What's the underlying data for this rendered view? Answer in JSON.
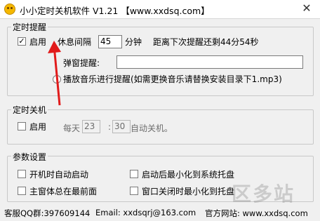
{
  "window": {
    "title": "小小定时关机软件 V1.21 【www.xxdsq.com】",
    "close_glyph": "✕"
  },
  "reminder": {
    "legend": "定时提醒",
    "enable_label": "启用",
    "enable_checked": true,
    "interval_label": "休息间隔",
    "interval_value": "45",
    "interval_unit": "分钟",
    "countdown_text": "距离下次提醒还剩44分54秒",
    "popup_label": "弹窗提醒:",
    "popup_value": "",
    "music_label": "播放音乐进行提醒(如需更换音乐请替换安装目录下1.mp3)"
  },
  "shutdown": {
    "legend": "定时关机",
    "enable_label": "启用",
    "enable_checked": false,
    "daily_label": "每天",
    "hour_value": "23",
    "separator": ":",
    "minute_value": "30",
    "suffix": "自动关机。"
  },
  "settings": {
    "legend": "参数设置",
    "autostart_label": "开机时自动启动",
    "minimize_tray_label": "启动后最小化到系统托盘",
    "always_top_label": "主窗体总在最前面",
    "close_tray_label": "窗口关闭时最小化到托盘"
  },
  "status": {
    "qq": "客服QQ群:397609144",
    "email": "Email: xxdsqrj@163.com",
    "website": "官方网站: www.xxdsq.com"
  },
  "watermark": "区多站",
  "accent_color": "#e11b1b"
}
